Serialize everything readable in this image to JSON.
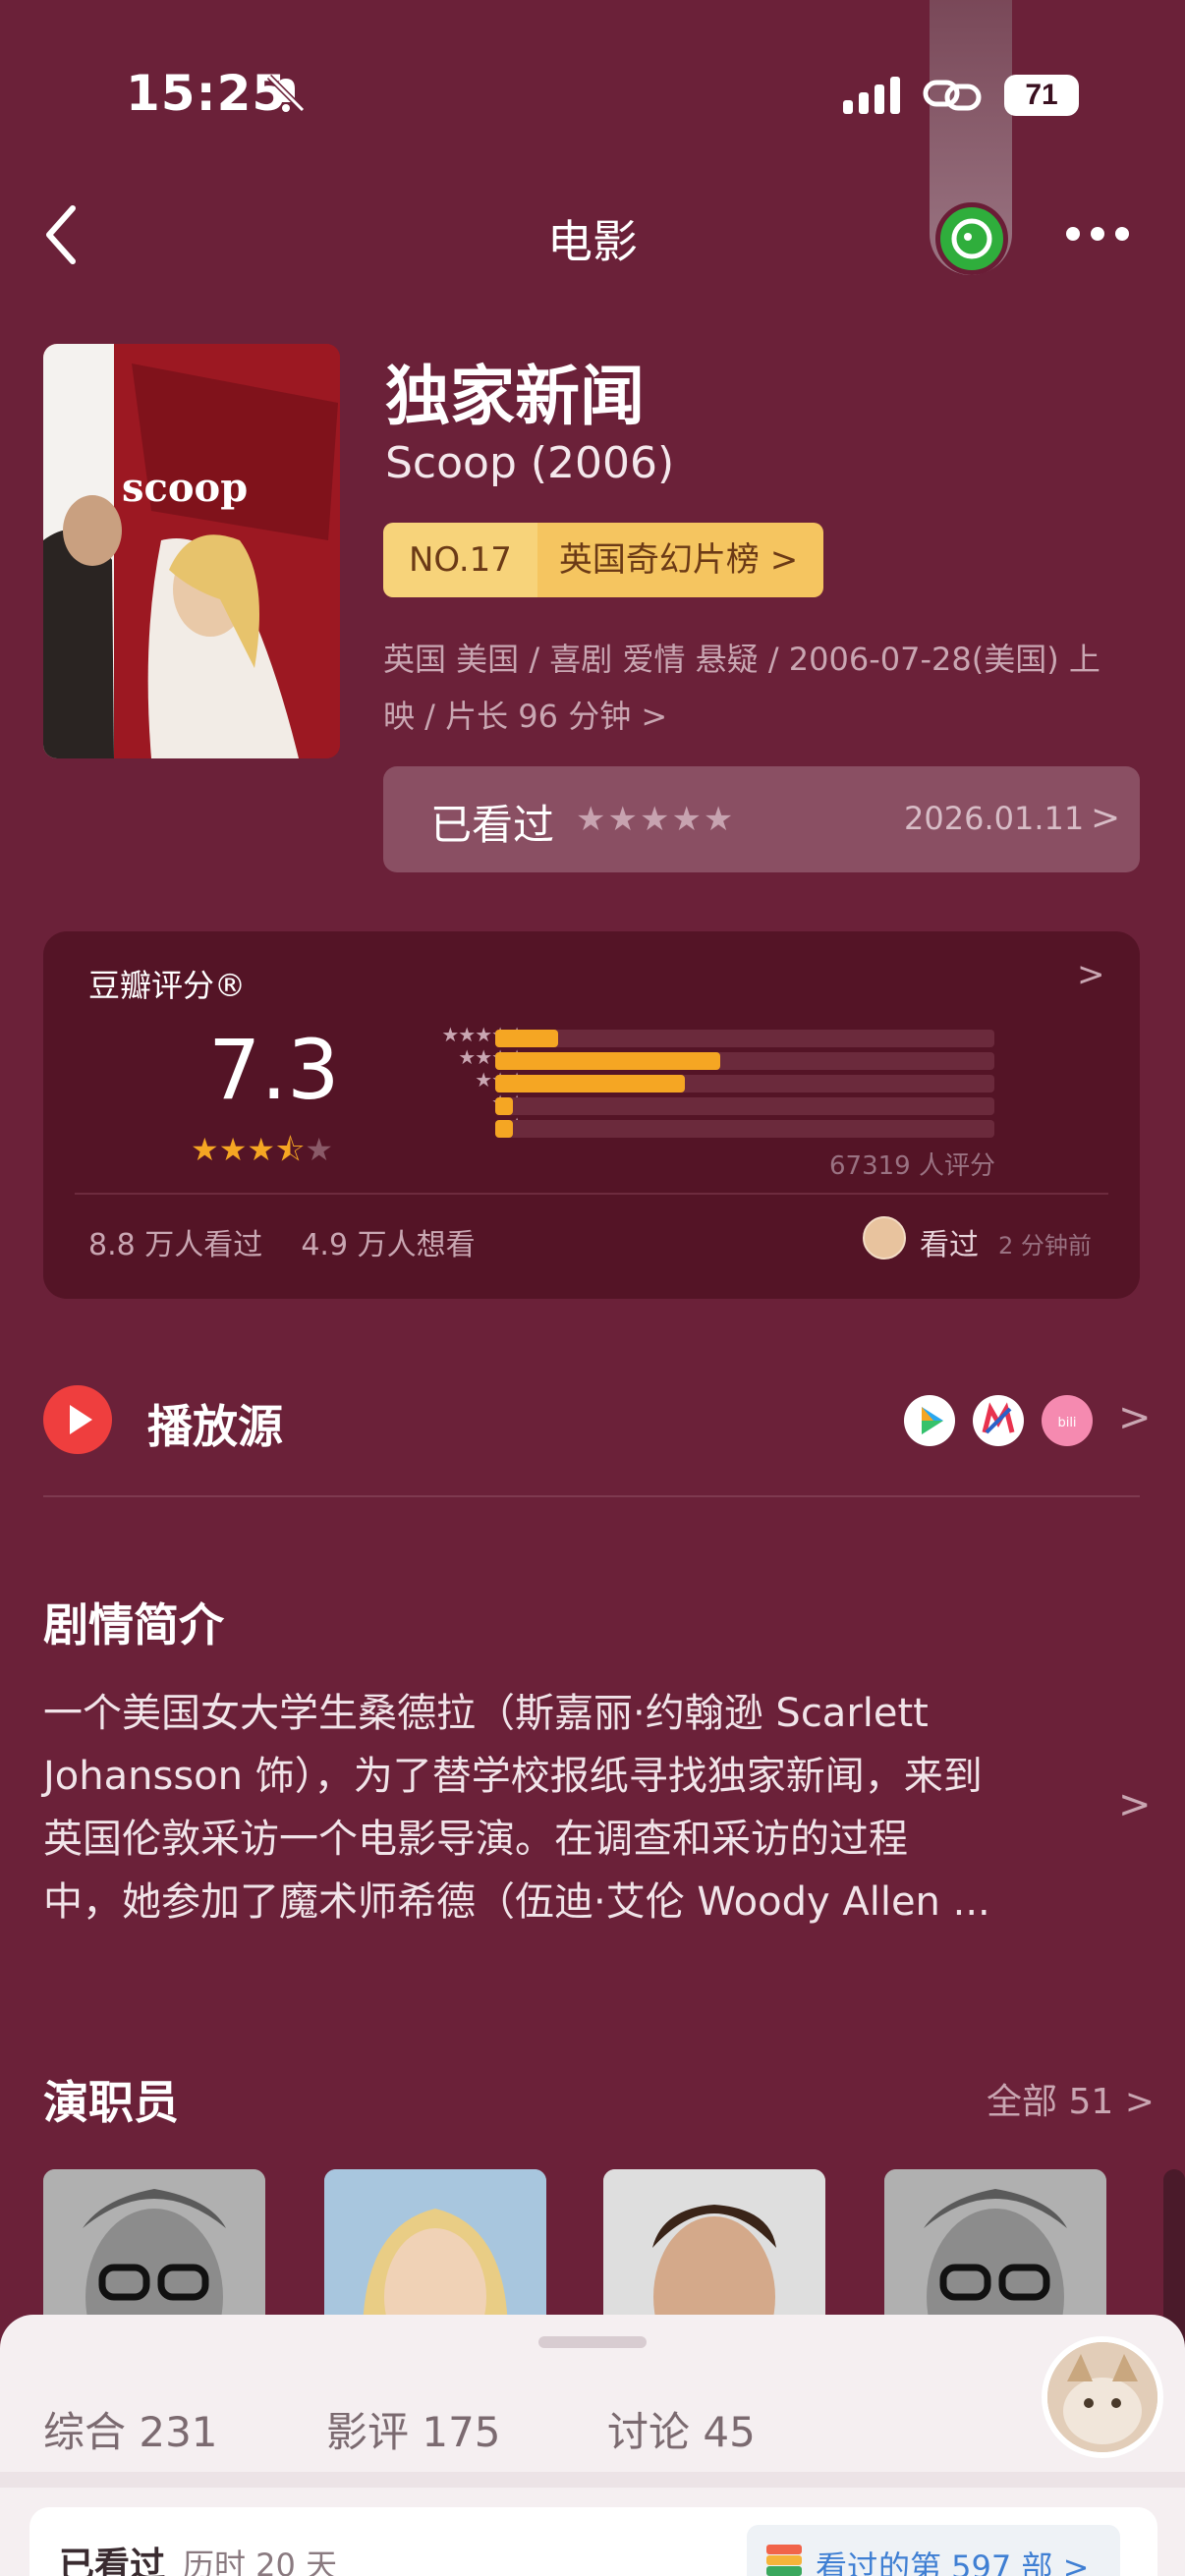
{
  "status_bar": {
    "time": "15:25",
    "battery": "71",
    "icons": [
      "bell-off-icon",
      "signal-icon",
      "link-icon",
      "battery-icon"
    ]
  },
  "nav": {
    "title": "电影",
    "icons": [
      "back-icon",
      "more-icon"
    ]
  },
  "movie": {
    "title_cn": "独家新闻",
    "title_en": "Scoop (2006)",
    "rank_no": "NO.17",
    "rank_list": "英国奇幻片榜 >",
    "meta_line1": "英国 美国 / 喜剧 爱情 悬疑 / 2006-07-28(美国) 上",
    "meta_line2": "映 / 片长 96 分钟 >",
    "poster_text": "scoop"
  },
  "watched": {
    "label": "已看过",
    "stars": "★★★★★",
    "date": "2026.01.11",
    "chevron": ">"
  },
  "rating": {
    "title": "豆瓣评分®",
    "score": "7.3",
    "stars": "★★★★★",
    "star_rows": [
      "★★★★★",
      "★★★★",
      "★★★",
      "★★",
      "★"
    ],
    "distribution": [
      0.125,
      0.45,
      0.38,
      0.035,
      0.035
    ],
    "count": "67319 人评分",
    "seen": "8.8 万人看过",
    "want": "4.9 万人想看",
    "my_status": "看过",
    "my_time": "2 分钟前",
    "chevron": ">"
  },
  "play_source": {
    "label": "播放源",
    "icons": [
      "tencent-video-icon",
      "mango-tv-icon",
      "bilibili-icon"
    ],
    "chevron": ">"
  },
  "synopsis": {
    "title": "剧情简介",
    "line1": "一个美国女大学生桑德拉（斯嘉丽·约翰逊 Scarlett",
    "line2": "Johansson 饰），为了替学校报纸寻找独家新闻，来到",
    "line3": "英国伦敦采访一个电影导演。在调查和采访的过程",
    "line4": "中，她参加了魔术师希德（伍迪·艾伦 Woody Allen ...",
    "chevron": ">"
  },
  "cast": {
    "title": "演职员",
    "all_label": "全部 51 >",
    "members": [
      "cast-photo-1",
      "cast-photo-2",
      "cast-photo-3",
      "cast-photo-4"
    ]
  },
  "bottom_sheet": {
    "tabs": [
      "综合 231",
      "影评 175",
      "讨论 45"
    ],
    "card_label": "已看过",
    "card_days": "历时 20 天",
    "card_badge": "看过的第 597 部 >"
  },
  "colors": {
    "background": "#6b2139",
    "card": "#541426",
    "accent": "#f5a623",
    "rank_badge": "#f5c560",
    "play_red": "#ef3e3e"
  }
}
